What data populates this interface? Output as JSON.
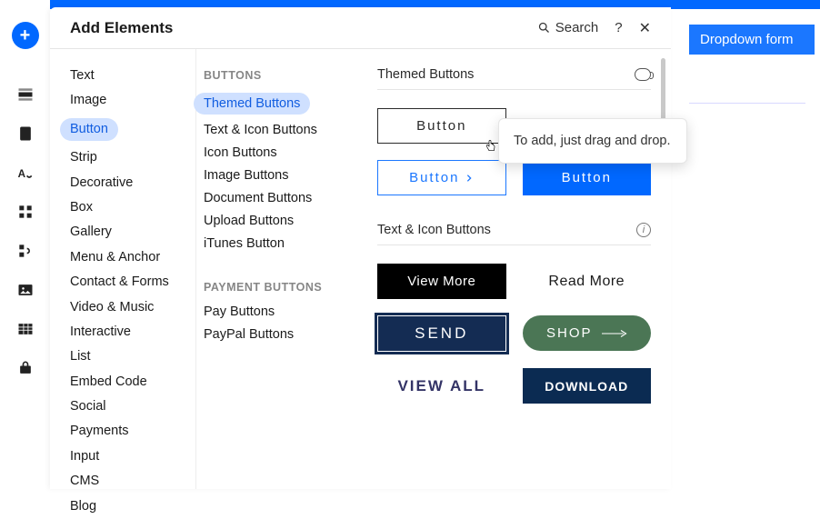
{
  "topbar_color": "#0168ff",
  "dropdown_form_label": "Dropdown form",
  "rail": [
    "plus",
    "pages",
    "document",
    "font-drop",
    "apps",
    "plugins",
    "image",
    "data",
    "store"
  ],
  "panel": {
    "title": "Add Elements",
    "search_label": "Search"
  },
  "col1": {
    "items": [
      "Text",
      "Image",
      "Button",
      "Strip",
      "Decorative",
      "Box",
      "Gallery",
      "Menu & Anchor",
      "Contact & Forms",
      "Video & Music",
      "Interactive",
      "List",
      "Embed Code",
      "Social",
      "Payments",
      "Input",
      "CMS",
      "Blog"
    ],
    "selected": "Button"
  },
  "col2": {
    "groups": [
      {
        "header": "BUTTONS",
        "items": [
          "Themed Buttons",
          "Text & Icon Buttons",
          "Icon Buttons",
          "Image Buttons",
          "Document Buttons",
          "Upload Buttons",
          "iTunes Button"
        ],
        "selected": "Themed Buttons"
      },
      {
        "header": "PAYMENT BUTTONS",
        "items": [
          "Pay Buttons",
          "PayPal Buttons"
        ]
      }
    ]
  },
  "preview": {
    "sections": [
      {
        "title": "Themed Buttons",
        "kind": "video-icon",
        "items": [
          {
            "style": "b-outline-black",
            "label": "Button"
          },
          null,
          {
            "style": "b-outline-blue",
            "label": "Button",
            "arrow": true
          },
          {
            "style": "b-solid-blue",
            "label": "Button"
          }
        ]
      },
      {
        "title": "Text & Icon Buttons",
        "kind": "info-icon",
        "items": [
          {
            "style": "b-solid-black",
            "label": "View More"
          },
          {
            "style": "b-plain",
            "label": "Read More"
          },
          {
            "style": "b-send",
            "label": "SEND"
          },
          {
            "style": "b-shop",
            "label": "SHOP",
            "long_arrow": true
          },
          {
            "style": "b-viewall",
            "label": "VIEW ALL"
          },
          {
            "style": "b-download",
            "label": "DOWNLOAD"
          }
        ]
      }
    ]
  },
  "tooltip_text": "To add, just drag and drop."
}
